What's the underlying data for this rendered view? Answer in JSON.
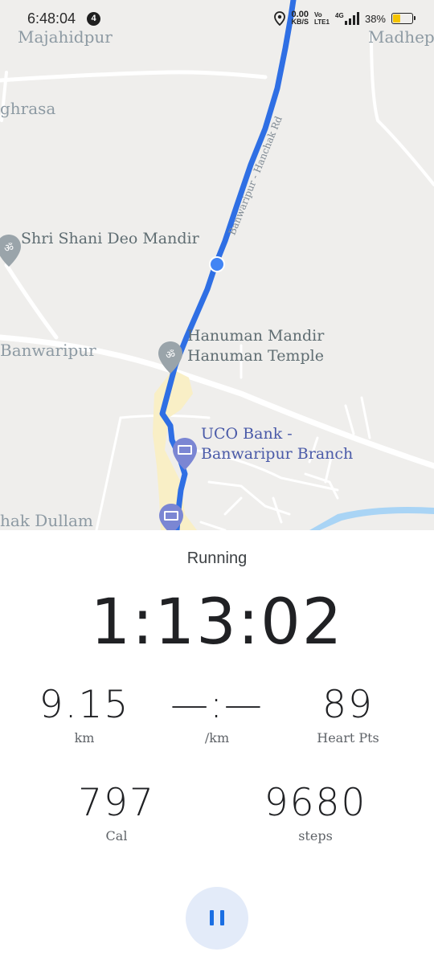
{
  "status_bar": {
    "time": "6:48:04",
    "notification_count": "4",
    "network_speed_value": "0.00",
    "network_speed_unit": "KB/S",
    "volte_top": "Vo",
    "volte_bottom": "LTE1",
    "network_type": "4G",
    "battery_percent": "38%",
    "battery_level": 0.38,
    "battery_color": "#f5c400"
  },
  "map": {
    "places": {
      "majahidpur": "Majahidpur",
      "madhep": "Madhep",
      "ghrasa": "ghrasa",
      "banwaripur": "Banwaripur",
      "hak_dullam": "hak Dullam"
    },
    "road_name": "Banwaripur - Hanchak Rd",
    "pois": {
      "shani_mandir": "Shri Shani Deo Mandir",
      "hanuman_line1": "Hanuman Mandir",
      "hanuman_line2": "Hanuman Temple",
      "uco_line1": "UCO Bank -",
      "uco_line2": "Banwaripur Branch"
    },
    "route_color": "#2f6fe4",
    "current_location_color": "#4285f4"
  },
  "workout": {
    "activity": "Running",
    "duration": "1:13:02",
    "distance": {
      "value": "9.15",
      "unit": "km"
    },
    "pace": {
      "value": "—:—",
      "unit": "/km"
    },
    "heart_points": {
      "value": "89",
      "unit": "Heart Pts"
    },
    "calories": {
      "value": "797",
      "unit": "Cal"
    },
    "steps": {
      "value": "9680",
      "unit": "steps"
    }
  },
  "controls": {
    "pause_icon": "pause-icon",
    "accent": "#1a6ee3"
  }
}
